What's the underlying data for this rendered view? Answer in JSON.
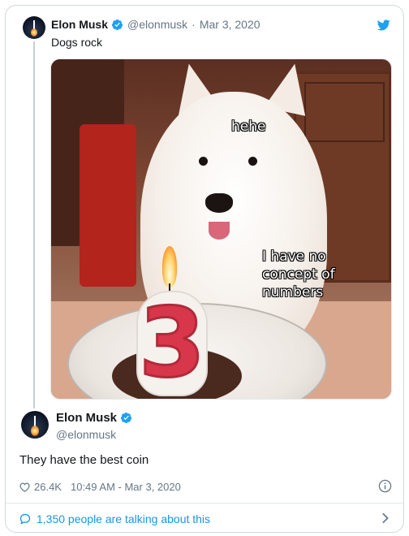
{
  "quoted_tweet": {
    "author_name": "Elon Musk",
    "handle": "@elonmusk",
    "separator": "·",
    "date": "Mar 3, 2020",
    "text": "Dogs rock",
    "image_captions": [
      "hehe",
      "I have no concept of numbers"
    ],
    "candle_number": "3"
  },
  "tweet": {
    "author_name": "Elon Musk",
    "handle": "@elonmusk",
    "text": "They have the best coin",
    "likes": "26.4K",
    "timestamp": "10:49 AM - Mar 3, 2020"
  },
  "footer": {
    "talking_text": "1,350 people are talking about this"
  },
  "colors": {
    "brand_blue": "#1da1f2",
    "link_blue": "#1b95e0",
    "text_primary": "#14171a",
    "text_secondary": "#657786",
    "border": "#cfd9de"
  },
  "icons": {
    "verified": "verified-badge-icon",
    "brand": "twitter-bird-icon",
    "like": "heart-icon",
    "info": "info-icon",
    "conversation": "speech-bubble-icon",
    "more": "chevron-right-icon"
  }
}
